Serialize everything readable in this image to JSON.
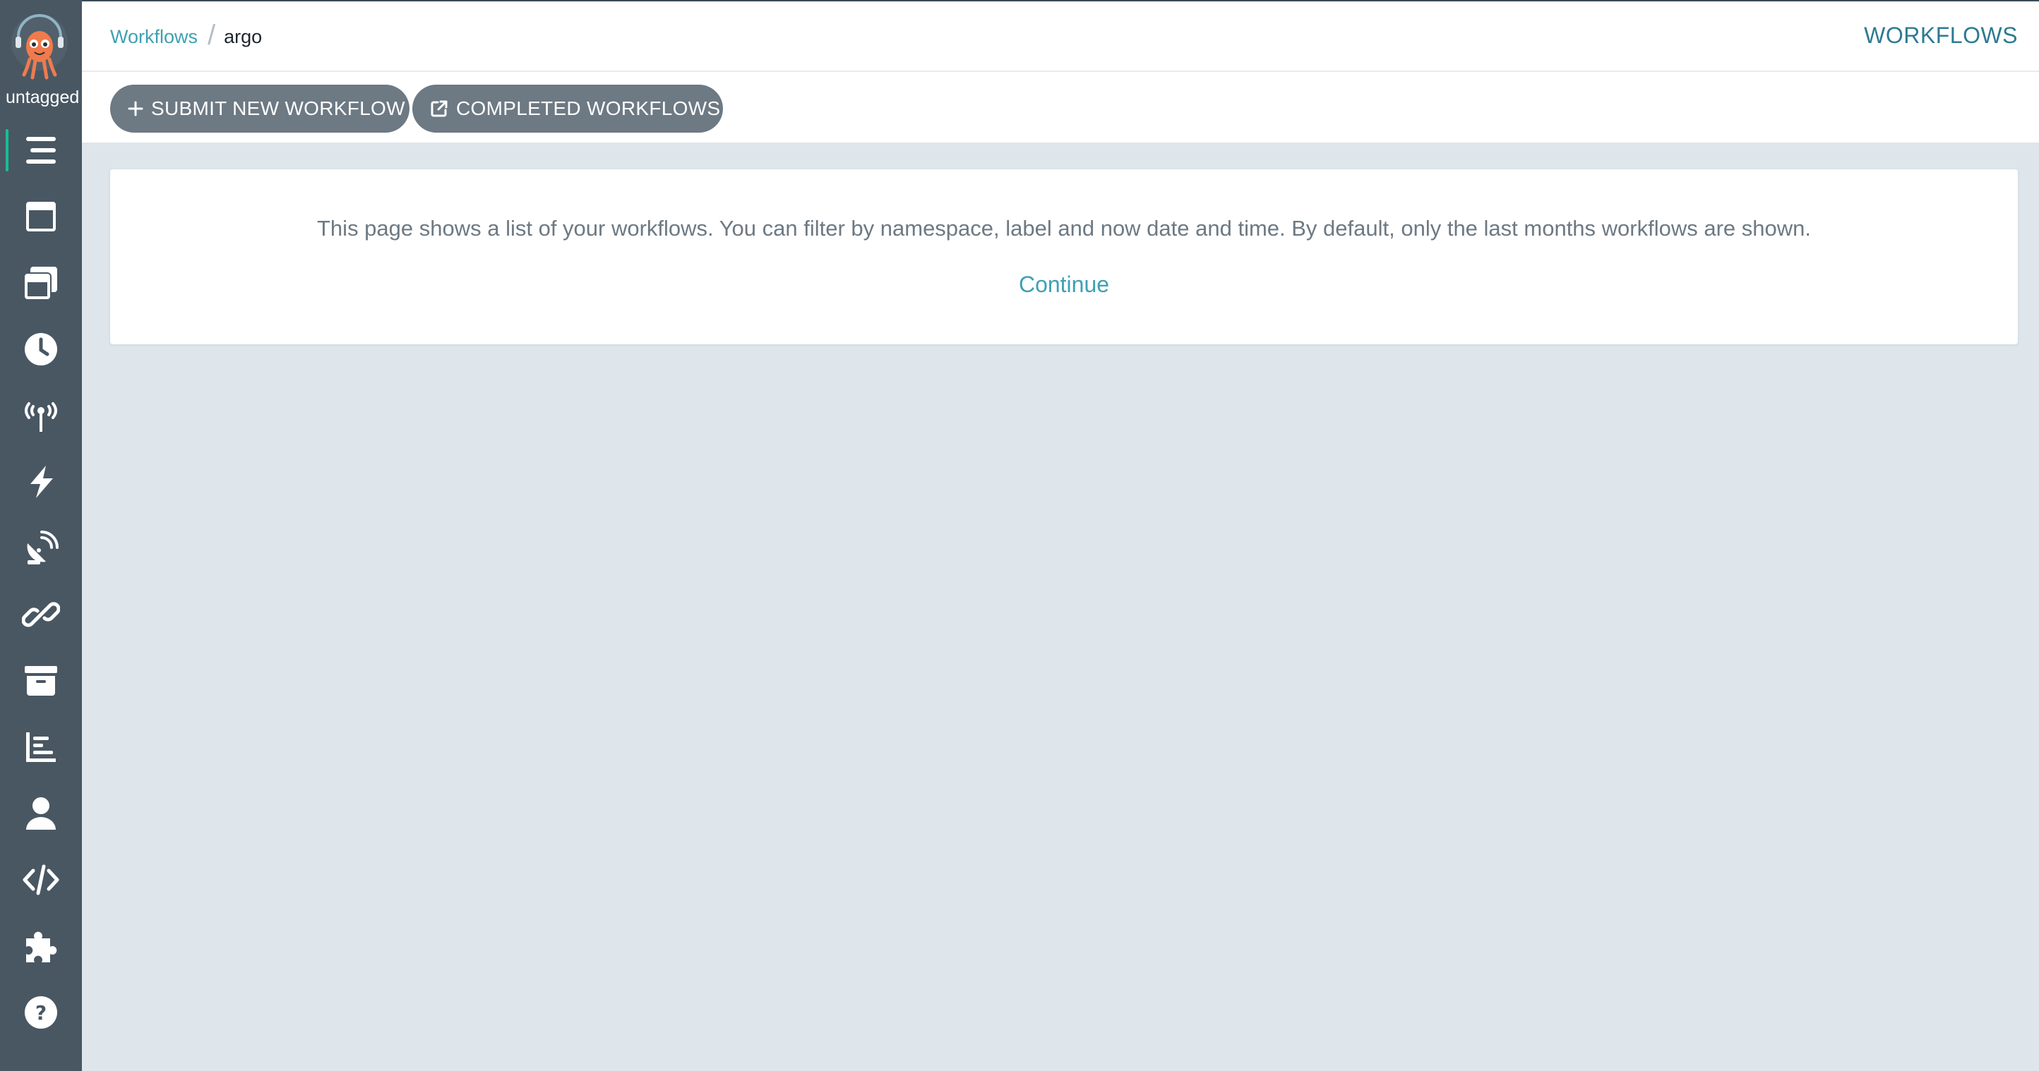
{
  "sidebar": {
    "version_label": "untagged",
    "items": [
      {
        "name": "workflows",
        "icon": "stream-icon",
        "active": true
      },
      {
        "name": "workflow-templates",
        "icon": "window-maximize-icon"
      },
      {
        "name": "cluster-workflow-templates",
        "icon": "window-restore-icon"
      },
      {
        "name": "cron-workflows",
        "icon": "clock-icon"
      },
      {
        "name": "event-sources",
        "icon": "broadcast-tower-icon"
      },
      {
        "name": "sensors",
        "icon": "satellite-dish-icon"
      },
      {
        "name": "event-flow",
        "icon": "bolt-icon"
      },
      {
        "name": "event-flow-links",
        "icon": "link-icon"
      },
      {
        "name": "archived-workflows",
        "icon": "archive-icon"
      },
      {
        "name": "reports",
        "icon": "chart-bar-icon"
      },
      {
        "name": "user",
        "icon": "user-icon"
      },
      {
        "name": "api-docs",
        "icon": "code-icon"
      },
      {
        "name": "plugins",
        "icon": "puzzle-piece-icon"
      },
      {
        "name": "help",
        "icon": "question-circle-icon"
      }
    ]
  },
  "header": {
    "breadcrumb_link": "Workflows",
    "breadcrumb_current": "argo",
    "page_title": "WORKFLOWS"
  },
  "toolbar": {
    "submit_label": "SUBMIT NEW WORKFLOW",
    "completed_label": "COMPLETED WORKFLOWS"
  },
  "info": {
    "message": "This page shows a list of your workflows. You can filter by namespace, label and now date and time. By default, only the last months workflows are shown.",
    "continue_label": "Continue"
  },
  "colors": {
    "sidebar_bg": "#495763",
    "accent": "#3fa0b4",
    "button_bg": "#6d7983",
    "page_bg": "#dee6eb"
  }
}
